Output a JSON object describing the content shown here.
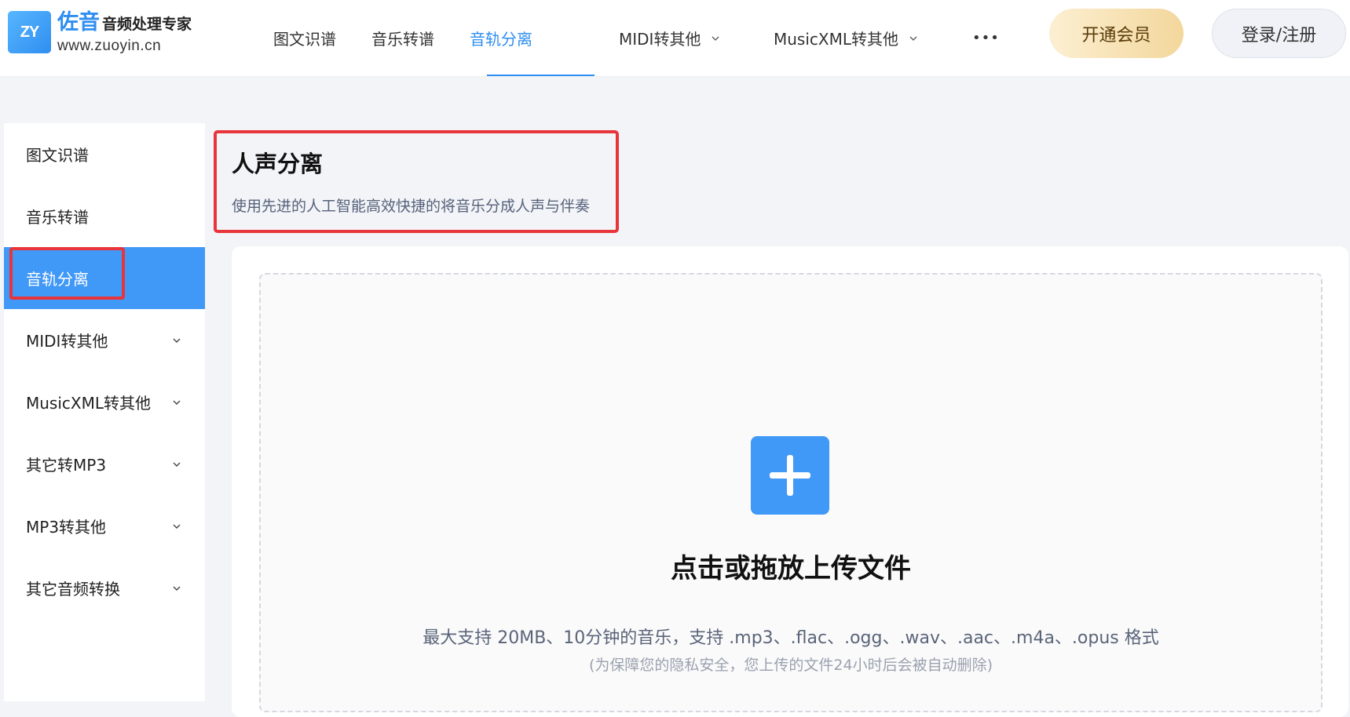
{
  "brand": {
    "mark": "ZY",
    "name": "佐音",
    "subtitle": "音频处理专家",
    "url": "www.zuoyin.cn"
  },
  "nav": {
    "items": [
      {
        "label": "图文识谱",
        "active": false,
        "dropdown": false
      },
      {
        "label": "音乐转谱",
        "active": false,
        "dropdown": false
      },
      {
        "label": "音轨分离",
        "active": true,
        "dropdown": false
      },
      {
        "label": "MIDI转其他",
        "active": false,
        "dropdown": true
      },
      {
        "label": "MusicXML转其他",
        "active": false,
        "dropdown": true
      }
    ],
    "more_label": "•••",
    "vip_label": "开通会员",
    "login_label": "登录/注册"
  },
  "sidebar": {
    "items": [
      {
        "label": "图文识谱",
        "active": false,
        "dropdown": false
      },
      {
        "label": "音乐转谱",
        "active": false,
        "dropdown": false
      },
      {
        "label": "音轨分离",
        "active": true,
        "dropdown": false
      },
      {
        "label": "MIDI转其他",
        "active": false,
        "dropdown": true
      },
      {
        "label": "MusicXML转其他",
        "active": false,
        "dropdown": true
      },
      {
        "label": "其它转MP3",
        "active": false,
        "dropdown": true
      },
      {
        "label": "MP3转其他",
        "active": false,
        "dropdown": true
      },
      {
        "label": "其它音频转换",
        "active": false,
        "dropdown": true
      }
    ]
  },
  "main": {
    "title": "人声分离",
    "description": "使用先进的人工智能高效快捷的将音乐分成人声与伴奏",
    "upload": {
      "title": "点击或拖放上传文件",
      "hint": "最大支持 20MB、10分钟的音乐，支持 .mp3、.flac、.ogg、.wav、.aac、.m4a、.opus 格式",
      "note": "(为保障您的隐私安全，您上传的文件24小时后会被自动删除)"
    }
  },
  "colors": {
    "accent": "#4098f7",
    "highlight_border": "#e8343b",
    "vip_gradient_start": "#fcefd2",
    "vip_gradient_end": "#f3d79c"
  },
  "icons": {
    "dropdown": "chevron-down-icon",
    "upload": "plus-icon",
    "more": "ellipsis-icon"
  }
}
